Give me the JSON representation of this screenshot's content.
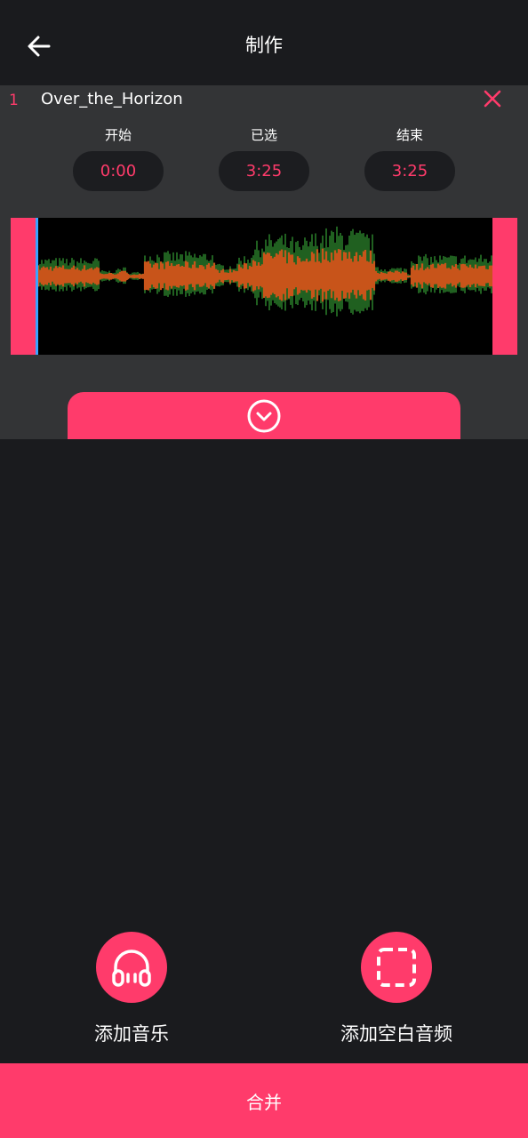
{
  "header": {
    "title": "制作",
    "back_icon": "arrow-left-icon"
  },
  "track": {
    "index": "1",
    "name": "Over_the_Horizon",
    "remove_icon": "close-icon",
    "start": {
      "label": "开始",
      "value": "0:00"
    },
    "selected": {
      "label": "已选",
      "value": "3:25"
    },
    "end": {
      "label": "结束",
      "value": "3:25"
    },
    "expand_icon": "chevron-down-circle-icon"
  },
  "actions": {
    "add_music": {
      "label": "添加音乐",
      "icon": "headphones-icon"
    },
    "add_blank": {
      "label": "添加空白音频",
      "icon": "dashed-square-icon"
    }
  },
  "merge": {
    "label": "合并"
  },
  "colors": {
    "accent": "#ff3b6b",
    "background": "#1a1b1e",
    "card": "#333436",
    "playhead": "#3aa4ff",
    "wave_orange": "#c8541a",
    "wave_green": "#2e8a2e"
  }
}
